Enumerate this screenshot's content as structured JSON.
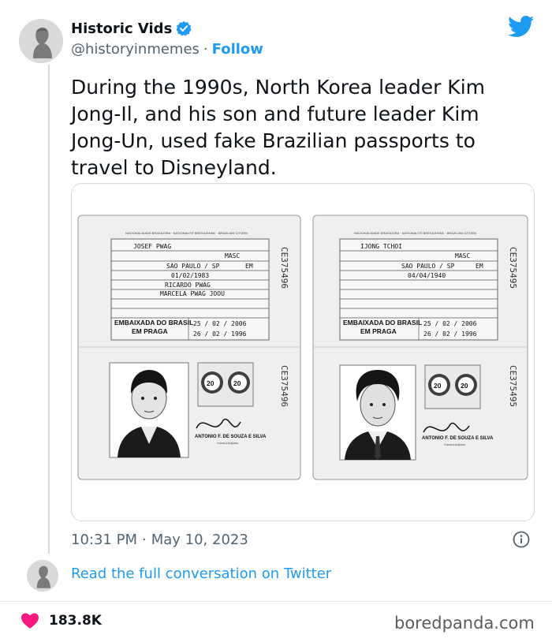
{
  "author": {
    "name": "Historic Vids",
    "handle": "@historyinmemes",
    "separator": "·",
    "follow_label": "Follow",
    "verified_icon": "verified-badge-icon"
  },
  "brand_icon": "twitter-bird-icon",
  "tweet": {
    "text": "During the 1990s, North Korea leader Kim Jong-Il, and his son and future leader Kim Jong-Un, used fake Brazilian passports to travel to Disneyland."
  },
  "media": {
    "passports": [
      {
        "surname": "JOSEF  PWAG",
        "sex": "MASC",
        "birthplace": "SAO PAULO / SP",
        "birthplace_suffix": "EM",
        "birth_date": "01/02/1983",
        "father": "RICARDO  PWAG",
        "mother": "MARCELA  PWAG  JOOU",
        "issued_by": "EMBAIXADA DO BRASIL",
        "issued_city": "EM PRAGA",
        "valid_until": "25 / 02 / 2006",
        "issue_date": "26 / 02 / 1996",
        "serial": "CE375496",
        "stamp_value": "20",
        "signature_name": "ANTONIO F. DE SOUZA E SILVA",
        "signature_title": "Consul-Adjunto"
      },
      {
        "surname": "IJONG  TCHOI",
        "sex": "MASC",
        "birthplace": "SAO PAULO / SP",
        "birthplace_suffix": "EM",
        "birth_date": "04/04/1940",
        "father": "",
        "mother": "",
        "issued_by": "EMBAIXADA DO BRASIL",
        "issued_city": "EM PRAGA",
        "valid_until": "25 / 02 / 2006",
        "issue_date": "26 / 02 / 1996",
        "serial": "CE375495",
        "stamp_value": "20",
        "signature_name": "ANTONIO F. DE SOUZA E SILVA",
        "signature_title": "Consul-Adjunto"
      }
    ]
  },
  "timestamp": {
    "time": "10:31 PM",
    "separator": "·",
    "date": "May 10, 2023"
  },
  "info_icon": "info-icon",
  "conversation_link": "Read the full conversation on Twitter",
  "likes": {
    "count": "183.8K",
    "icon": "heart-icon",
    "color": "#f91880"
  },
  "watermark": "boredpanda.com",
  "colors": {
    "accent": "#1d9bf0",
    "text": "#0f1419",
    "muted": "#536471"
  }
}
